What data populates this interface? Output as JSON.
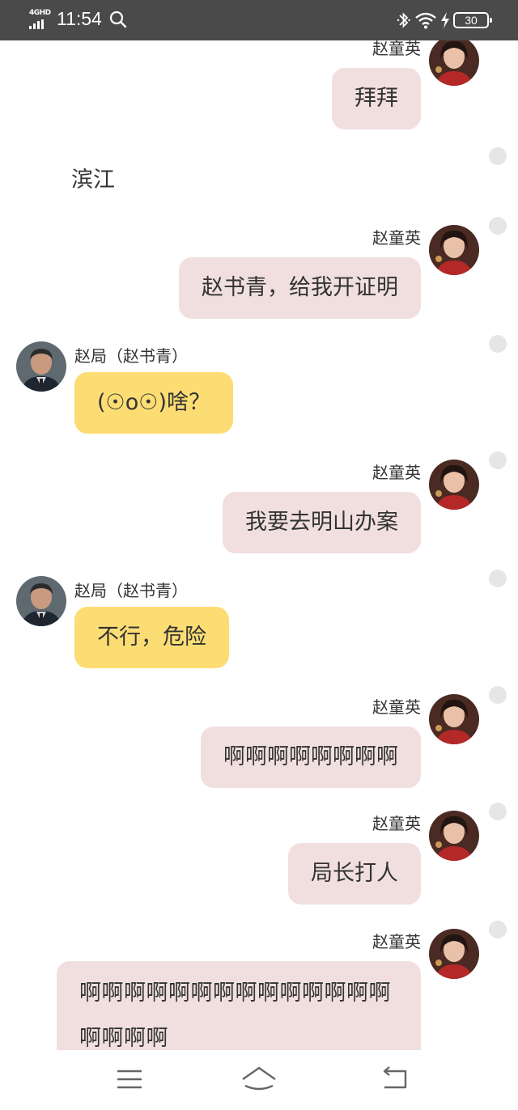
{
  "status_bar": {
    "network": "4GHD",
    "time": "11:54",
    "battery": "30"
  },
  "chat": {
    "contacts": {
      "me": "赵童英",
      "other": "赵局（赵书青）"
    },
    "messages": [
      {
        "type": "out",
        "sender": "赵童英",
        "text": "拜拜"
      },
      {
        "type": "plain",
        "text": "滨江"
      },
      {
        "type": "out",
        "sender": "赵童英",
        "text": "赵书青，给我开证明"
      },
      {
        "type": "in",
        "sender": "赵局（赵书青）",
        "text": "(☉o☉)啥？"
      },
      {
        "type": "out",
        "sender": "赵童英",
        "text": "我要去明山办案"
      },
      {
        "type": "in",
        "sender": "赵局（赵书青）",
        "text": "不行，危险"
      },
      {
        "type": "out",
        "sender": "赵童英",
        "text": "啊啊啊啊啊啊啊啊"
      },
      {
        "type": "out",
        "sender": "赵童英",
        "text": "局长打人"
      },
      {
        "type": "out",
        "sender": "赵童英",
        "text": "啊啊啊啊啊啊啊啊啊啊啊啊啊啊啊啊啊啊"
      }
    ]
  },
  "colors": {
    "status_bar_bg": "#4a4a4a",
    "outgoing_bubble": "#f1dfe0",
    "incoming_bubble": "#fcdd74",
    "read_dot": "#e6e6e6"
  },
  "icons": {
    "status": [
      "signal-icon",
      "search-icon",
      "bluetooth-icon",
      "wifi-icon",
      "charging-icon",
      "battery-icon"
    ],
    "nav": [
      "menu-icon",
      "home-icon",
      "back-icon"
    ]
  }
}
